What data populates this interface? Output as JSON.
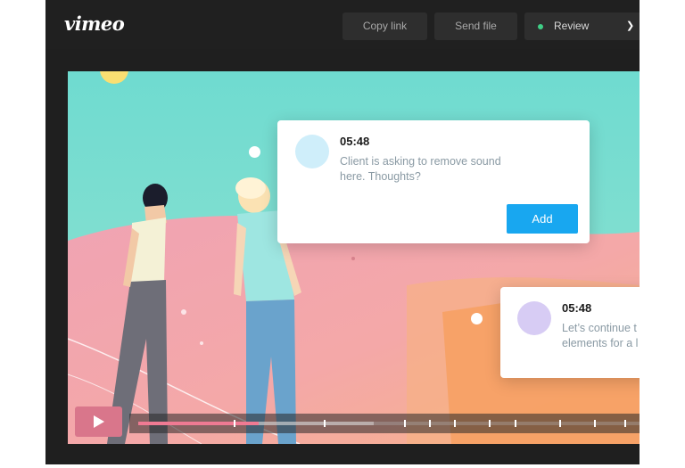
{
  "app": {
    "logo": "vimeo",
    "toolbar": {
      "copy_link": "Copy link",
      "send_file": "Send file",
      "review": "Review",
      "review_icon": "chevron-down-icon"
    }
  },
  "player": {
    "progress": 0.24,
    "buffered": 0.47,
    "comment_markers": [
      0.19,
      0.37,
      0.53,
      0.58,
      0.63,
      0.7,
      0.75,
      0.84,
      0.91,
      0.97
    ]
  },
  "comments": [
    {
      "time": "05:48",
      "text": "Client is asking to remove sound here. Thoughts?",
      "button": "Add",
      "avatar_color": "#cfeefa"
    },
    {
      "time": "05:48",
      "line1": "Let’s continue t",
      "line2": "elements for a l",
      "avatar_color": "#d7ccf4"
    }
  ],
  "colors": {
    "accent": "#18a7f0",
    "status_dot": "#3fce86",
    "play_button": "#d9768b",
    "progress_fill": "#ef7a93"
  }
}
